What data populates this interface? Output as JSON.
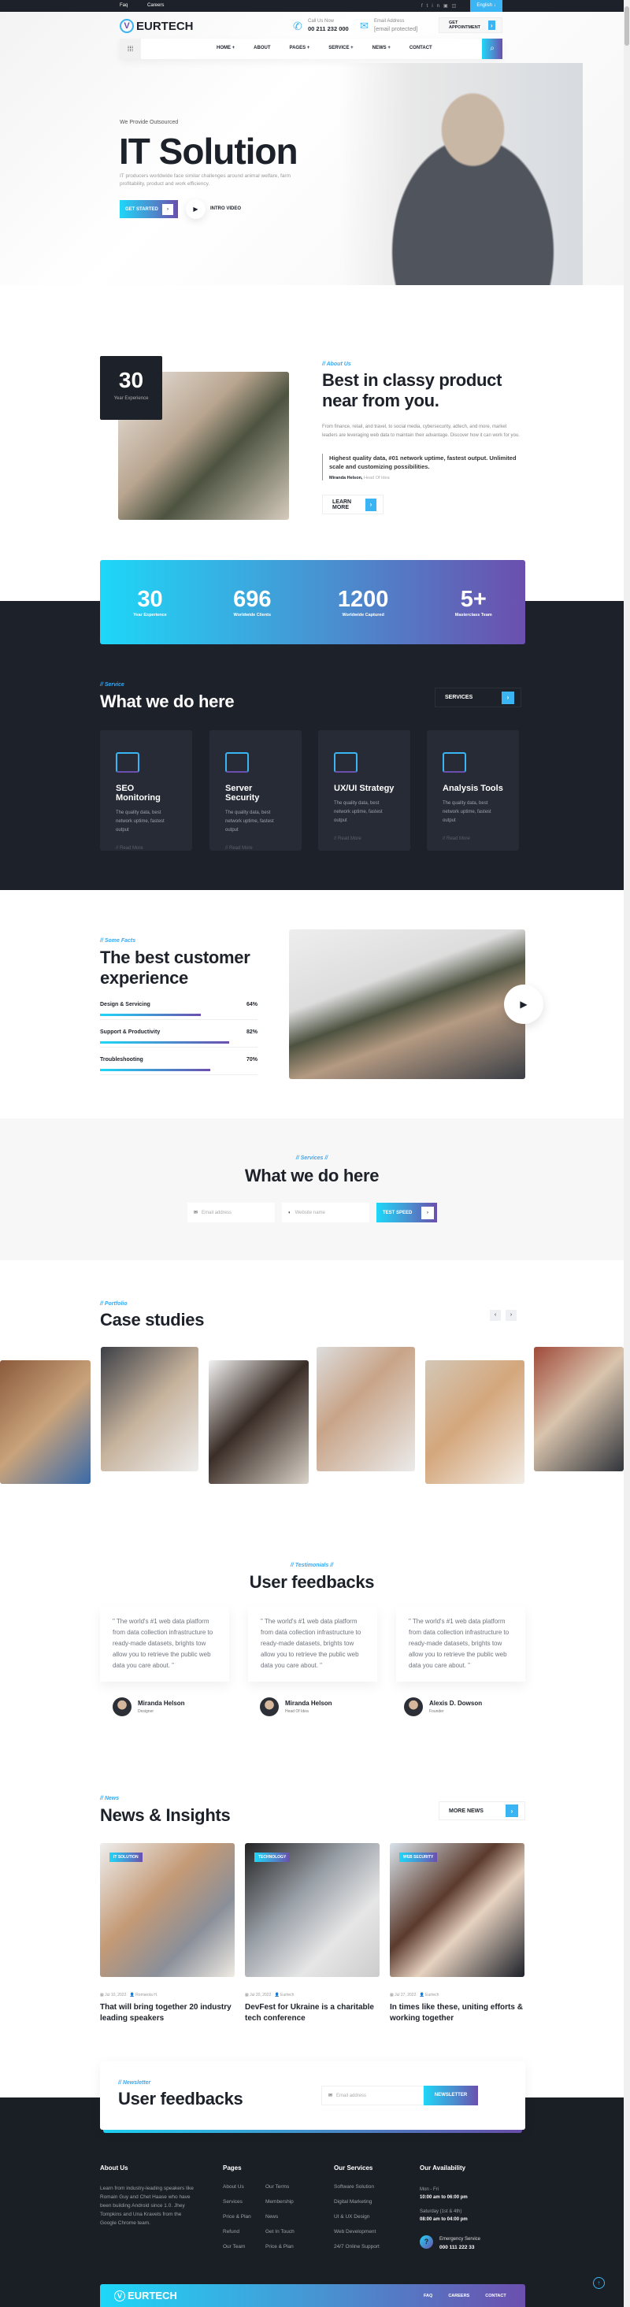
{
  "topbar": {
    "links": [
      "Faq",
      "Careers"
    ],
    "social_icons": [
      "facebook-icon",
      "twitter-icon",
      "linkedin-icon",
      "youtube-icon",
      "instagram-icon"
    ],
    "language": "English"
  },
  "header": {
    "logo": "EURTECH",
    "call_label": "Call Us Now",
    "phone": "00 211 232 000",
    "email_label": "Email Address",
    "email": "[email protected]",
    "appointment": "GET APPOINTMENT"
  },
  "nav": {
    "items": [
      "HOME +",
      "ABOUT",
      "PAGES +",
      "SERVICE +",
      "NEWS +",
      "CONTACT"
    ]
  },
  "hero": {
    "kicker": "We Provide Outsourced",
    "title": "IT Solution",
    "text": "IT producers worldwide face similar challenges around animal welfare, farm profitability, product and work efficiency.",
    "cta": "GET STARTED",
    "video": "INTRO VIDEO"
  },
  "about": {
    "years": "30",
    "years_label": "Year Experience",
    "tag": "// About Us",
    "title": "Best in classy product near from you.",
    "text": "From finance, retail, and travel, to social media, cybersecurity, adtech, and more, market leaders are leveraging web data to maintain their advantage. Discover how it can work for you.",
    "quote": "Highest quality data, #01 network uptime, fastest output. Unlimited scale and customizing possibilities.",
    "author": "Miranda Helson,",
    "role": "Head Of Idea",
    "button": "LEARN MORE"
  },
  "stats": [
    {
      "value": "30",
      "label": "Year Experience"
    },
    {
      "value": "696",
      "label": "Worldwide Clients"
    },
    {
      "value": "1200",
      "label": "Worldwide Captured"
    },
    {
      "value": "5+",
      "label": "Masterclass Team"
    }
  ],
  "services": {
    "tag": "// Service",
    "title": "What we do here",
    "button": "SERVICES",
    "cards": [
      {
        "title": "SEO Monitoring",
        "text": "The quality data, best network uptime, fastest output",
        "link": "// Read More",
        "icon": "seo-monitor-icon"
      },
      {
        "title": "Server Security",
        "text": "The quality data, best network uptime, fastest output",
        "link": "// Read More",
        "icon": "server-security-icon"
      },
      {
        "title": "UX/UI Strategy",
        "text": "The quality data, best network uptime, fastest output",
        "link": "// Read More",
        "icon": "ux-strategy-icon"
      },
      {
        "title": "Analysis Tools",
        "text": "The quality data, best network uptime, fastest output",
        "link": "// Read More",
        "icon": "analysis-tools-icon"
      }
    ]
  },
  "facts": {
    "tag": "// Some Facts",
    "title": "The best customer experience",
    "bars": [
      {
        "label": "Design & Servicing",
        "value": 64,
        "text": "64%"
      },
      {
        "label": "Support & Productivity",
        "value": 82,
        "text": "82%"
      },
      {
        "label": "Troubleshooting",
        "value": 70,
        "text": "70%"
      }
    ]
  },
  "speed": {
    "tag": "// Services //",
    "title": "What we do here",
    "email_placeholder": "Email address",
    "website_placeholder": "Website name",
    "button": "TEST SPEED"
  },
  "cases": {
    "tag": "// Portfolio",
    "title": "Case studies"
  },
  "testimonials": {
    "tag": "// Testimonials //",
    "title": "User feedbacks",
    "items": [
      {
        "quote": "\" The world's #1 web data platform from data collection infrastructure to ready-made datasets, brights tow allow you to retrieve the public web data you care about. \"",
        "name": "Miranda Helson",
        "role": "Designer"
      },
      {
        "quote": "\" The world's #1 web data platform from data collection infrastructure to ready-made datasets, brights tow allow you to retrieve the public web data you care about. \"",
        "name": "Miranda Helson",
        "role": "Head Of Idea"
      },
      {
        "quote": "\" The world's #1 web data platform from data collection infrastructure to ready-made datasets, brights tow allow you to retrieve the public web data you care about. \"",
        "name": "Alexis D. Dowson",
        "role": "Founder"
      }
    ]
  },
  "news": {
    "tag": "// News",
    "title": "News & Insights",
    "button": "MORE NEWS",
    "items": [
      {
        "badge": "IT SOLUTION",
        "date": "Jul 10, 2022",
        "author": "Romarola H.",
        "title": "That will bring together 20 industry leading speakers"
      },
      {
        "badge": "TECHNOLOGY",
        "date": "Jul 20, 2022",
        "author": "Eurtech",
        "title": "DevFest for Ukraine is a charitable tech conference"
      },
      {
        "badge": "WEB SECURITY",
        "date": "Jul 27, 2022",
        "author": "Eurtech",
        "title": "In times like these, uniting efforts & working together"
      }
    ]
  },
  "newsletter": {
    "tag": "// Newsletter",
    "title": "User feedbacks",
    "placeholder": "Email address",
    "button": "NEWSLETTER"
  },
  "footer": {
    "about_title": "About Us",
    "about_text": "Learn from industry-leading speakers like Romain Guy and Chet Haase who have been building Android since 1.0. Jhey Tompkins and Una Kravets from the Google Chrome team.",
    "pages_title": "Pages",
    "pages": [
      "About Us",
      "Our Terms",
      "Services",
      "Membership",
      "Price & Plan",
      "News",
      "Refund",
      "Get In Touch",
      "Our Team",
      "Price & Plan"
    ],
    "services_title": "Our Services",
    "services": [
      "Software Solution",
      "Digital Marketing",
      "UI & UX Design",
      "Web Development",
      "24/7 Online Support"
    ],
    "avail_title": "Our Availability",
    "weekday": "Mon - Fri",
    "weekday_hours": "10:00 am to 06:00 pm",
    "saturday": "Saturday (1st & 4th)",
    "saturday_hours": "08:00 am to 04:00 pm",
    "emergency_label": "Emergency Service",
    "emergency_phone": "000 111 222 33",
    "bottom_logo": "EURTECH",
    "bottom_links": [
      "FAQ",
      "CAREERS",
      "CONTACT"
    ]
  },
  "colors": {
    "dark": "#1d2129",
    "accent": "#3ab4f2",
    "grad_start": "#1ed7f8",
    "grad_end": "#6b4fae"
  }
}
